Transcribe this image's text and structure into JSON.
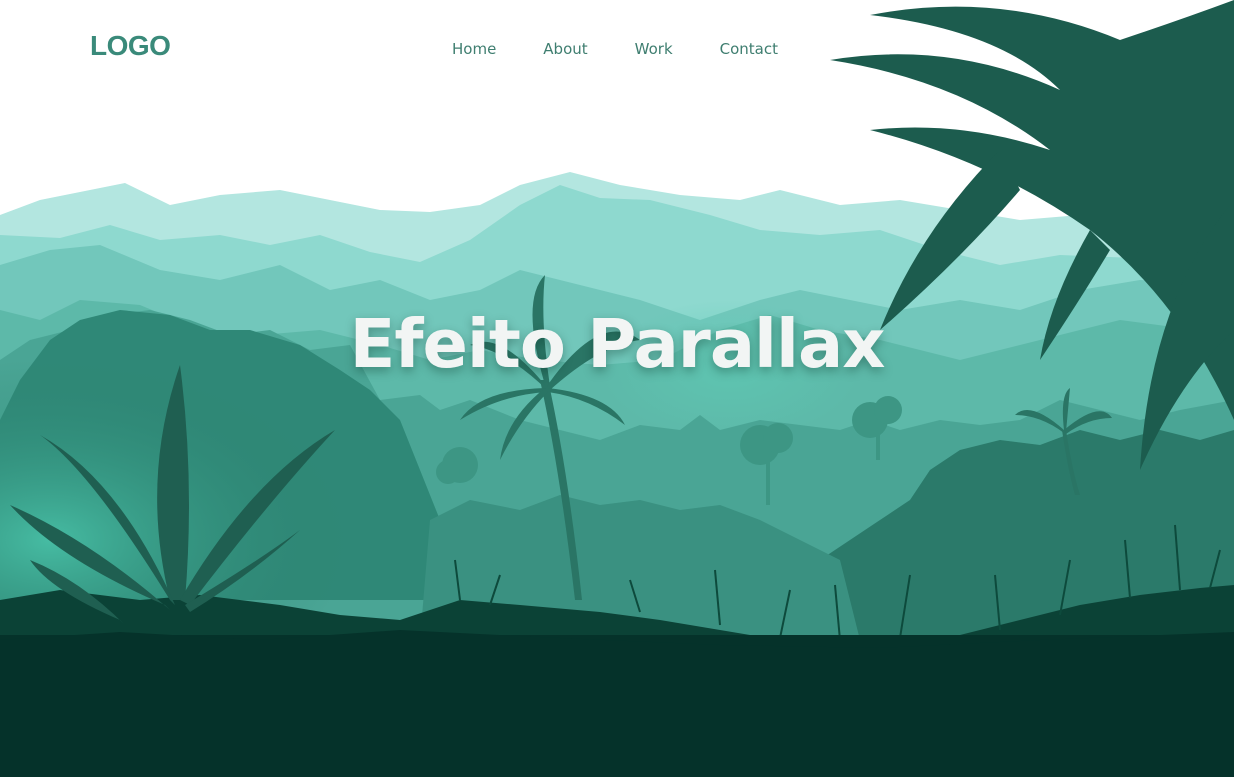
{
  "header": {
    "logo": "LOGO",
    "nav": [
      {
        "label": "Home"
      },
      {
        "label": "About"
      },
      {
        "label": "Work"
      },
      {
        "label": "Contact"
      }
    ]
  },
  "hero": {
    "title": "Efeito Parallax"
  },
  "colors": {
    "background": "#ffffff",
    "logo": "#3a8a7a",
    "nav_text": "#3f7e70",
    "title_text": "#f2f5f4",
    "ground": "#05322a",
    "mountain_far": "#b3e6e0",
    "mountain_mid": "#8ed9cf",
    "fern": "#1c5c4e"
  }
}
